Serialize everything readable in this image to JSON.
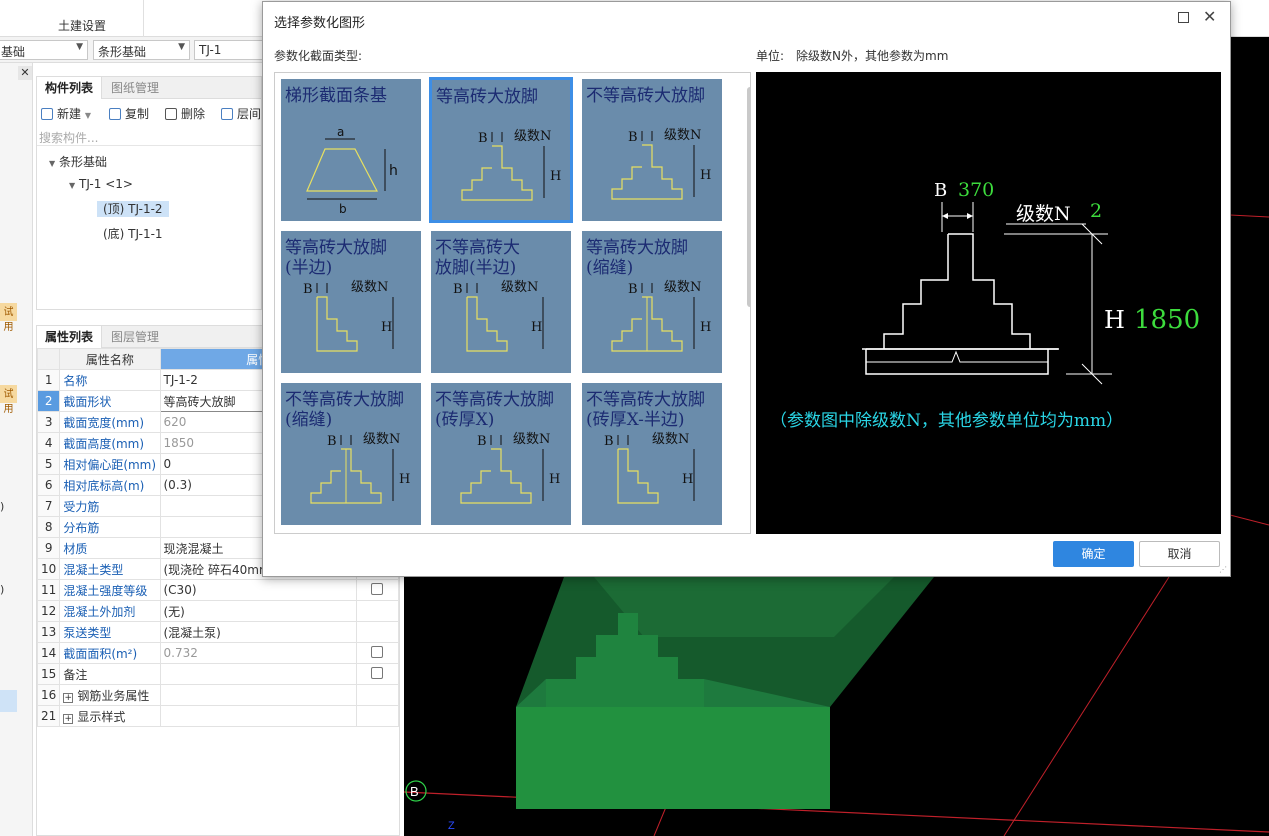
{
  "ribbon": {
    "tab": "土建设置"
  },
  "selectors": {
    "floor": "基础",
    "category": "条形基础",
    "component": "TJ-1"
  },
  "left_strip": {
    "badge1": "试用",
    "badge2": "试用",
    "mark1": ")",
    "mark2": ")"
  },
  "component_panel": {
    "tabs": [
      "构件列表",
      "图纸管理"
    ],
    "toolbar": {
      "new": "新建",
      "copy": "复制",
      "delete": "删除",
      "layer": "层间"
    },
    "search_placeholder": "搜索构件...",
    "tree": {
      "root": "条形基础",
      "group": "TJ-1 <1>",
      "top": "(顶) TJ-1-2",
      "bottom": "(底) TJ-1-1"
    }
  },
  "property_panel": {
    "tabs": [
      "属性列表",
      "图层管理"
    ],
    "headers": {
      "name": "属性名称",
      "value": "属性"
    },
    "rows": [
      {
        "n": "1",
        "name": "名称",
        "value": "TJ-1-2"
      },
      {
        "n": "2",
        "name": "截面形状",
        "value": "等高砖大放脚"
      },
      {
        "n": "3",
        "name": "截面宽度(mm)",
        "value": "620"
      },
      {
        "n": "4",
        "name": "截面高度(mm)",
        "value": "1850"
      },
      {
        "n": "5",
        "name": "相对偏心距(mm)",
        "value": "0"
      },
      {
        "n": "6",
        "name": "相对底标高(m)",
        "value": "(0.3)"
      },
      {
        "n": "7",
        "name": "受力筋",
        "value": ""
      },
      {
        "n": "8",
        "name": "分布筋",
        "value": ""
      },
      {
        "n": "9",
        "name": "材质",
        "value": "现浇混凝土"
      },
      {
        "n": "10",
        "name": "混凝土类型",
        "value": "(现浇砼 碎石40mm"
      },
      {
        "n": "11",
        "name": "混凝土强度等级",
        "value": "(C30)"
      },
      {
        "n": "12",
        "name": "混凝土外加剂",
        "value": "(无)"
      },
      {
        "n": "13",
        "name": "泵送类型",
        "value": "(混凝土泵)"
      },
      {
        "n": "14",
        "name": "截面面积(m²)",
        "value": "0.732"
      },
      {
        "n": "15",
        "name": "备注",
        "value": ""
      },
      {
        "n": "16",
        "name": "钢筋业务属性",
        "value": ""
      },
      {
        "n": "21",
        "name": "显示样式",
        "value": ""
      }
    ]
  },
  "dialog": {
    "title": "选择参数化图形",
    "type_label": "参数化截面类型:",
    "unit_label": "单位:　除级数N外，其他参数为mm",
    "shapes": [
      {
        "line1": "梯形截面条基",
        "line2": ""
      },
      {
        "line1": "等高砖大放脚",
        "line2": ""
      },
      {
        "line1": "不等高砖大放脚",
        "line2": ""
      },
      {
        "line1": "等高砖大放脚",
        "line2": "(半边)"
      },
      {
        "line1": "不等高砖大",
        "line2": "放脚(半边)"
      },
      {
        "line1": "等高砖大放脚",
        "line2": "(缩缝)"
      },
      {
        "line1": "不等高砖大放脚",
        "line2": "(缩缝)"
      },
      {
        "line1": "不等高砖大放脚",
        "line2": "(砖厚X)"
      },
      {
        "line1": "不等高砖大放脚",
        "line2": "(砖厚X-半边)"
      }
    ],
    "preview": {
      "b_label": "B",
      "b_value": "370",
      "n_label": "级数N",
      "n_value": "2",
      "h_label": "H",
      "h_value": "1850",
      "note": "（参数图中除级数N，其他参数单位均为mm）"
    },
    "ok": "确定",
    "cancel": "取消"
  },
  "view3d": {
    "axis_label": "B"
  },
  "colors": {
    "accent": "#2f86e0",
    "thumb_bg": "#6a8cab",
    "green_value": "#3ddc3d",
    "note_cyan": "#2ad6e6",
    "foundation": "#1e7a3e"
  }
}
